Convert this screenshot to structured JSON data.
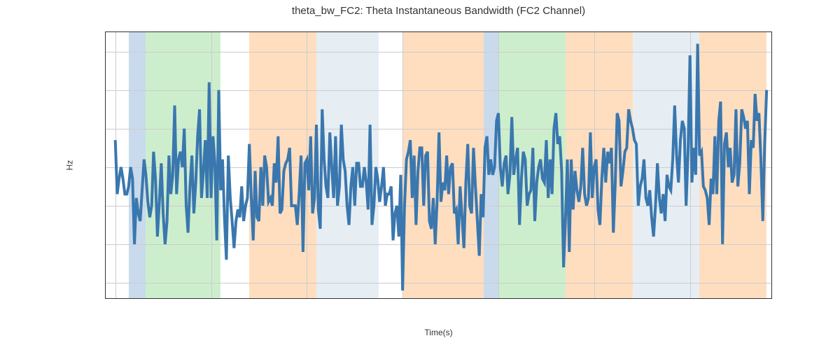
{
  "chart_data": {
    "type": "line",
    "title": "theta_bw_FC2: Theta Instantaneous Bandwidth (FC2 Channel)",
    "xlabel": "Time(s)",
    "ylabel": "Hz",
    "xlim": [
      -100,
      6850
    ],
    "ylim": [
      1.36,
      2.05
    ],
    "xticks": [
      0,
      1000,
      2000,
      3000,
      4000,
      5000,
      6000
    ],
    "yticks": [
      1.4,
      1.5,
      1.6,
      1.7,
      1.8,
      1.9,
      2.0
    ],
    "regions": [
      {
        "start": 140,
        "end": 320,
        "color": "blue"
      },
      {
        "start": 320,
        "end": 1100,
        "color": "green"
      },
      {
        "start": 1400,
        "end": 2100,
        "color": "orange"
      },
      {
        "start": 2100,
        "end": 2750,
        "color": "lightblue"
      },
      {
        "start": 3000,
        "end": 3850,
        "color": "orange"
      },
      {
        "start": 3850,
        "end": 4000,
        "color": "blue"
      },
      {
        "start": 4000,
        "end": 4700,
        "color": "green"
      },
      {
        "start": 4700,
        "end": 5400,
        "color": "orange"
      },
      {
        "start": 5400,
        "end": 6100,
        "color": "lightblue"
      },
      {
        "start": 6100,
        "end": 6800,
        "color": "orange"
      }
    ],
    "series": [
      {
        "name": "theta_bw_FC2",
        "color": "#3a77ae",
        "x_step": 20,
        "values": [
          1.77,
          1.63,
          1.67,
          1.7,
          1.67,
          1.63,
          1.63,
          1.65,
          1.7,
          1.67,
          1.5,
          1.62,
          1.58,
          1.56,
          1.64,
          1.72,
          1.68,
          1.61,
          1.57,
          1.6,
          1.74,
          1.67,
          1.52,
          1.61,
          1.71,
          1.58,
          1.5,
          1.56,
          1.73,
          1.63,
          1.68,
          1.86,
          1.63,
          1.72,
          1.74,
          1.7,
          1.8,
          1.6,
          1.53,
          1.65,
          1.73,
          1.58,
          1.66,
          1.78,
          1.85,
          1.62,
          1.69,
          1.77,
          1.62,
          1.92,
          1.62,
          1.78,
          1.71,
          1.51,
          1.9,
          1.64,
          1.72,
          1.57,
          1.46,
          1.73,
          1.62,
          1.56,
          1.49,
          1.56,
          1.59,
          1.57,
          1.65,
          1.56,
          1.6,
          1.62,
          1.76,
          1.62,
          1.51,
          1.69,
          1.57,
          1.56,
          1.7,
          1.6,
          1.73,
          1.7,
          1.61,
          1.62,
          1.6,
          1.71,
          1.66,
          1.78,
          1.58,
          1.59,
          1.69,
          1.71,
          1.72,
          1.75,
          1.6,
          1.6,
          1.6,
          1.55,
          1.63,
          1.73,
          1.48,
          1.71,
          1.72,
          1.64,
          1.78,
          1.58,
          1.62,
          1.81,
          1.59,
          1.54,
          1.85,
          1.72,
          1.65,
          1.62,
          1.79,
          1.7,
          1.62,
          1.78,
          1.6,
          1.65,
          1.81,
          1.72,
          1.69,
          1.6,
          1.55,
          1.65,
          1.7,
          1.6,
          1.71,
          1.71,
          1.65,
          1.65,
          1.7,
          1.66,
          1.59,
          1.81,
          1.55,
          1.6,
          1.7,
          1.67,
          1.61,
          1.65,
          1.7,
          1.6,
          1.63,
          1.63,
          1.65,
          1.51,
          1.58,
          1.6,
          1.52,
          1.68,
          1.38,
          1.6,
          1.72,
          1.74,
          1.77,
          1.62,
          1.73,
          1.55,
          1.69,
          1.75,
          1.75,
          1.6,
          1.73,
          1.74,
          1.56,
          1.54,
          1.62,
          1.5,
          1.61,
          1.79,
          1.61,
          1.66,
          1.64,
          1.73,
          1.63,
          1.7,
          1.71,
          1.58,
          1.59,
          1.5,
          1.65,
          1.57,
          1.49,
          1.66,
          1.76,
          1.6,
          1.58,
          1.75,
          1.65,
          1.56,
          1.47,
          1.63,
          1.57,
          1.75,
          1.78,
          1.68,
          1.72,
          1.68,
          1.7,
          1.82,
          1.84,
          1.7,
          1.65,
          1.71,
          1.73,
          1.63,
          1.68,
          1.83,
          1.68,
          1.72,
          1.75,
          1.55,
          1.67,
          1.74,
          1.72,
          1.6,
          1.63,
          1.64,
          1.75,
          1.56,
          1.66,
          1.7,
          1.72,
          1.67,
          1.66,
          1.77,
          1.62,
          1.72,
          1.63,
          1.8,
          1.84,
          1.76,
          1.78,
          1.69,
          1.44,
          1.56,
          1.72,
          1.48,
          1.72,
          1.59,
          1.69,
          1.64,
          1.61,
          1.65,
          1.75,
          1.63,
          1.6,
          1.62,
          1.79,
          1.62,
          1.7,
          1.72,
          1.59,
          1.55,
          1.67,
          1.75,
          1.66,
          1.74,
          1.71,
          1.75,
          1.53,
          1.66,
          1.84,
          1.82,
          1.65,
          1.69,
          1.74,
          1.75,
          1.85,
          1.82,
          1.8,
          1.77,
          1.76,
          1.6,
          1.65,
          1.67,
          1.72,
          1.62,
          1.6,
          1.64,
          1.57,
          1.52,
          1.6,
          1.71,
          1.62,
          1.58,
          1.63,
          1.56,
          1.68,
          1.65,
          1.64,
          1.72,
          1.86,
          1.73,
          1.66,
          1.77,
          1.82,
          1.8,
          1.6,
          1.74,
          1.99,
          1.66,
          1.75,
          1.68,
          2.02,
          1.73,
          1.74,
          1.65,
          1.64,
          1.62,
          1.55,
          1.67,
          1.63,
          1.78,
          1.63,
          1.82,
          1.87,
          1.5,
          1.76,
          1.79,
          1.7,
          1.75,
          1.66,
          1.68,
          1.85,
          1.65,
          1.71,
          1.85,
          1.83,
          1.8,
          1.82,
          1.63,
          1.77,
          1.75,
          1.89,
          1.82,
          1.84,
          1.72,
          1.56,
          1.76,
          1.9
        ]
      }
    ]
  }
}
